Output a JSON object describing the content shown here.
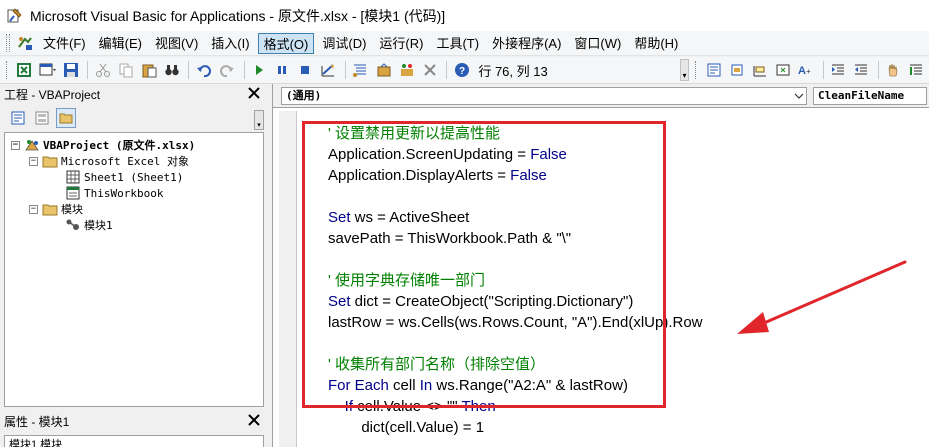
{
  "titlebar": {
    "title": "Microsoft Visual Basic for Applications - 原文件.xlsx - [模块1 (代码)]"
  },
  "menu": [
    {
      "label": "文件(F)",
      "active": false
    },
    {
      "label": "编辑(E)",
      "active": false
    },
    {
      "label": "视图(V)",
      "active": false
    },
    {
      "label": "插入(I)",
      "active": false
    },
    {
      "label": "格式(O)",
      "active": true
    },
    {
      "label": "调试(D)",
      "active": false
    },
    {
      "label": "运行(R)",
      "active": false
    },
    {
      "label": "工具(T)",
      "active": false
    },
    {
      "label": "外接程序(A)",
      "active": false
    },
    {
      "label": "窗口(W)",
      "active": false
    },
    {
      "label": "帮助(H)",
      "active": false
    }
  ],
  "toolbar": {
    "cursor_position": "行 76, 列 13"
  },
  "project_panel": {
    "title": "工程 - VBAProject",
    "tree": [
      {
        "label": "VBAProject (原文件.xlsx)",
        "icon": "vbaproject-icon",
        "twist": "−",
        "level": 0
      },
      {
        "label": "Microsoft Excel 对象",
        "icon": "folder-icon",
        "twist": "−",
        "level": 1
      },
      {
        "label": "Sheet1 (Sheet1)",
        "icon": "sheet-icon",
        "twist": "",
        "level": 2
      },
      {
        "label": "ThisWorkbook",
        "icon": "workbook-icon",
        "twist": "",
        "level": 2
      },
      {
        "label": "模块",
        "icon": "folder-icon",
        "twist": "−",
        "level": 1
      },
      {
        "label": "模块1",
        "icon": "module-icon",
        "twist": "",
        "level": 2
      }
    ]
  },
  "props_panel": {
    "title": "属性 - 模块1",
    "row_text": "模块1 模块"
  },
  "code_window": {
    "object_combo": "(通用)",
    "procedure_combo": "CleanFileName",
    "lines": [
      [
        {
          "t": "' 设置禁用更新以提高性能",
          "c": "cm"
        }
      ],
      [
        {
          "t": "Application.ScreenUpdating = ",
          "c": ""
        },
        {
          "t": "False",
          "c": "kw"
        }
      ],
      [
        {
          "t": "Application.DisplayAlerts = ",
          "c": ""
        },
        {
          "t": "False",
          "c": "kw"
        }
      ],
      [],
      [
        {
          "t": "Set",
          "c": "kw"
        },
        {
          "t": " ws = ActiveSheet",
          "c": ""
        }
      ],
      [
        {
          "t": "savePath = ThisWorkbook.Path & \"\\\"",
          "c": ""
        }
      ],
      [],
      [
        {
          "t": "' 使用字典存储唯一部门",
          "c": "cm"
        }
      ],
      [
        {
          "t": "Set",
          "c": "kw"
        },
        {
          "t": " dict = CreateObject(\"Scripting.Dictionary\")",
          "c": ""
        }
      ],
      [
        {
          "t": "lastRow = ws.Cells(ws.Rows.Count, \"A\").End(xlUp).Row",
          "c": ""
        }
      ],
      [],
      [
        {
          "t": "' 收集所有部门名称（排除空值）",
          "c": "cm"
        }
      ],
      [
        {
          "t": "For Each",
          "c": "kw"
        },
        {
          "t": " cell ",
          "c": ""
        },
        {
          "t": "In",
          "c": "kw"
        },
        {
          "t": " ws.Range(\"A2:A\" & lastRow)",
          "c": ""
        }
      ],
      [
        {
          "t": "    ",
          "c": ""
        },
        {
          "t": "If",
          "c": "kw"
        },
        {
          "t": " cell.Value <> \"\" ",
          "c": ""
        },
        {
          "t": "Then",
          "c": "kw"
        }
      ],
      [
        {
          "t": "        dict(cell.Value) = 1",
          "c": ""
        }
      ]
    ]
  },
  "annotation": {
    "box_color": "#e0262a",
    "arrow_color": "#e0262a"
  }
}
